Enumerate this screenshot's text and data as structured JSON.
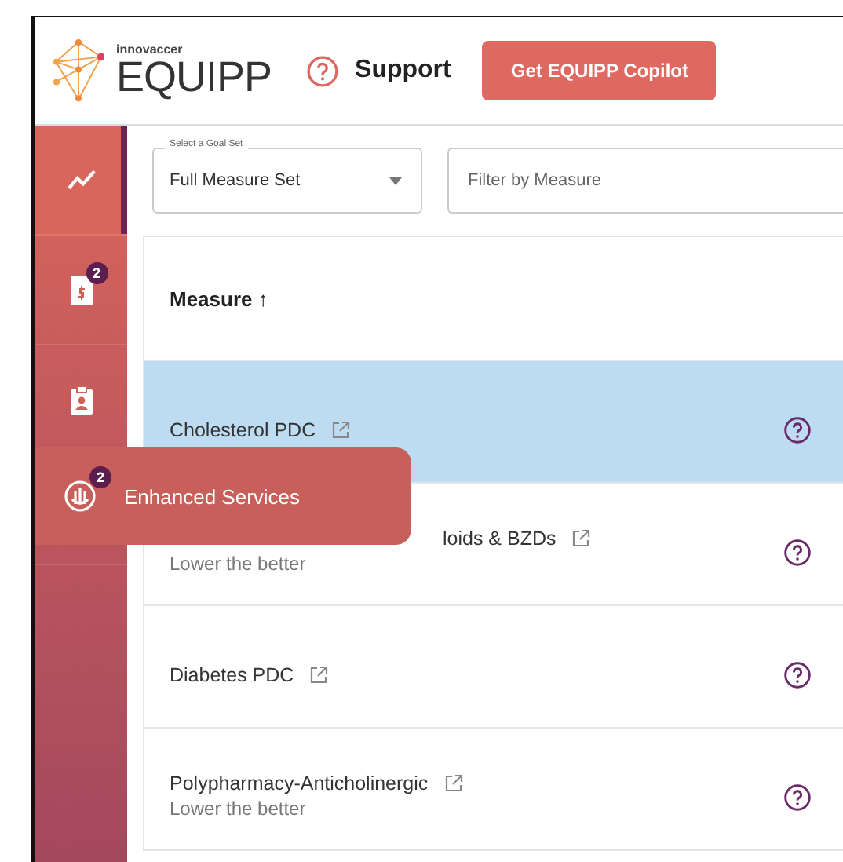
{
  "header": {
    "brand_small": "innovaccer",
    "brand": "EQUIPP",
    "support": "Support",
    "cta": "Get EQUIPP Copilot"
  },
  "sidebar": {
    "items": [
      {
        "kind": "chart",
        "selected": true
      },
      {
        "kind": "bill",
        "selected": false,
        "badge": "2"
      },
      {
        "kind": "clipboard",
        "selected": false
      },
      {
        "kind": "hand",
        "selected": false,
        "badge": "2",
        "label": "Enhanced Services",
        "hovered": true
      }
    ]
  },
  "filters": {
    "goal_label": "Select a Goal Set",
    "goal_value": "Full Measure Set",
    "filter_placeholder": "Filter by Measure"
  },
  "table": {
    "column": "Measure",
    "sort": "↑",
    "rows": [
      {
        "name": "Cholesterol PDC",
        "selected": true
      },
      {
        "name": "loids & BZDs",
        "note": "Lower the better",
        "selected": false
      },
      {
        "name": "Diabetes PDC",
        "selected": false
      },
      {
        "name": "Polypharmacy-Anticholinergic",
        "note": "Lower the better",
        "selected": false
      }
    ]
  }
}
